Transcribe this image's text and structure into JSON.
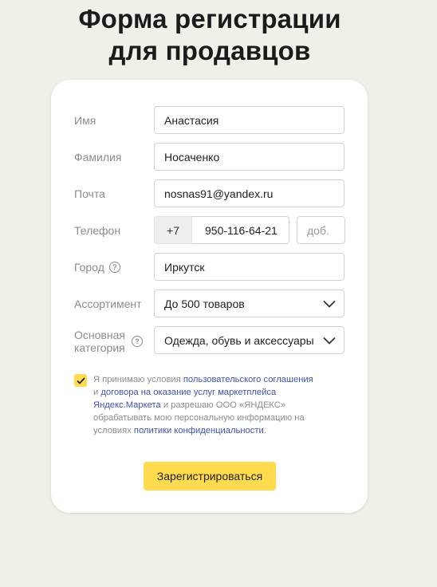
{
  "page": {
    "title_line1": "Форма регистрации",
    "title_line2": "для продавцов"
  },
  "form": {
    "name": {
      "label": "Имя",
      "value": "Анастасия"
    },
    "surname": {
      "label": "Фамилия",
      "value": "Носаченко"
    },
    "email": {
      "label": "Почта",
      "value": "nosnas91@yandex.ru"
    },
    "phone": {
      "label": "Телефон",
      "code": "+7",
      "number": "950-116-64-21",
      "ext_placeholder": "доб."
    },
    "city": {
      "label": "Город",
      "value": "Иркутск"
    },
    "assortment": {
      "label": "Ассортимент",
      "selected": "До 500 товаров"
    },
    "category": {
      "label_line1": "Основная",
      "label_line2": "категория",
      "selected": "Одежда, обувь и аксессуары"
    }
  },
  "consent": {
    "checked": true,
    "t1": "Я принимаю условия ",
    "link1": "пользовательского соглашения",
    "t2": "и ",
    "link2": "договора на оказание услуг маркетплейса Яндекс.Маркета",
    "t3": " и разрешаю ООО «ЯНДЕКС» обрабатывать мою персональную информацию на условиях ",
    "link3": "политики конфиденциальности",
    "t4": "."
  },
  "submit": {
    "label": "Зарегистрироваться"
  },
  "colors": {
    "accent": "#ffdb4d",
    "link": "#3f51b5",
    "background": "#f2efe9"
  },
  "icons": {
    "help": "question-circle-icon",
    "chevron": "chevron-down-icon",
    "check": "checkmark-icon"
  }
}
